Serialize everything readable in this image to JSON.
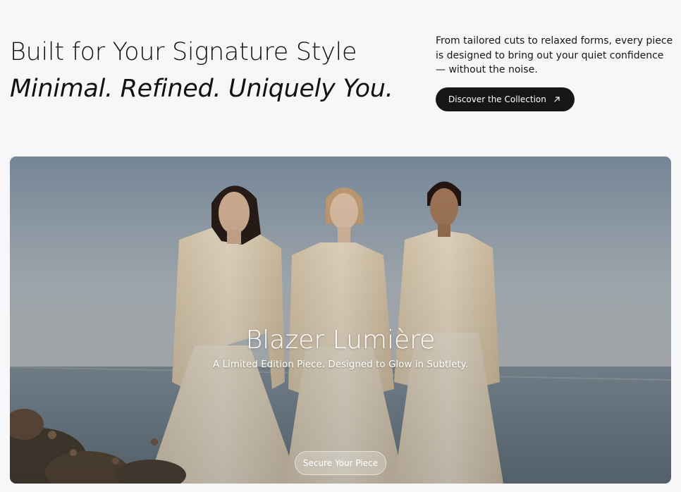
{
  "header": {
    "headline_line1": "Built for Your Signature Style",
    "headline_line2": "Minimal. Refined. Uniquely You.",
    "description": "From tailored cuts to relaxed forms, every piece is designed to bring out your quiet confidence — without the noise.",
    "cta_label": "Discover the Collection",
    "cta_icon": "arrow-up-right-icon"
  },
  "hero": {
    "title": "Blazer Lumière",
    "subtitle": "A Limited Edition Piece. Designed to Glow in Subtlety.",
    "cta_label": "Secure Your Piece",
    "image_description": "three models in cream shirts and skirts standing by the sea"
  },
  "colors": {
    "page_background": "#f7f7f9",
    "text": "#121212",
    "button_dark": "#161616",
    "garment": "#efe1c8",
    "sea": "#7f8f9c"
  }
}
